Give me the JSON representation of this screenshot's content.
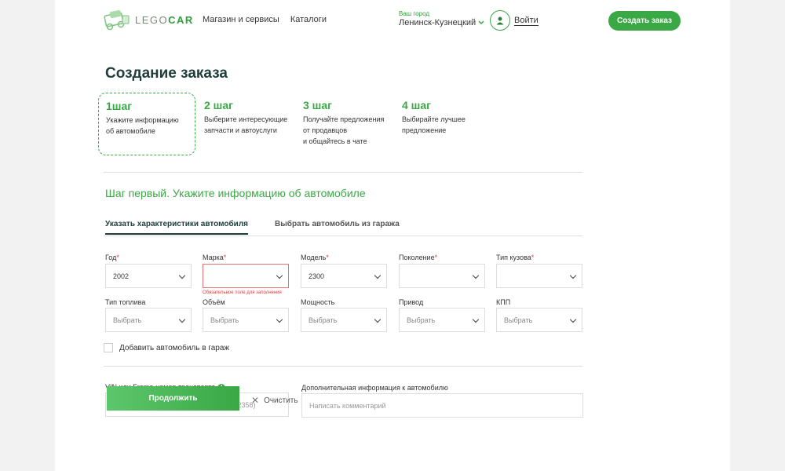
{
  "header": {
    "logo_light": "LEGO",
    "logo_bold": "CAR",
    "nav": [
      "Магазин и сервисы",
      "Каталоги"
    ],
    "city_label": "Ваш город",
    "city_value": "Ленинск-Кузнецкий",
    "login": "Войти",
    "create_order": "Создать заказ"
  },
  "page_title": "Создание заказа",
  "steps": [
    {
      "num": "1шаг",
      "line1": "Укажите информацию",
      "line2": "об автомобиле",
      "line3": ""
    },
    {
      "num": "2 шаг",
      "line1": "Выберите интересующие",
      "line2": "запчасти и автоуслуги",
      "line3": ""
    },
    {
      "num": "3 шаг",
      "line1": "Получайте предложения",
      "line2": "от продавцов",
      "line3": "и общайтесь в чате"
    },
    {
      "num": "4 шаг",
      "line1": "Выбирайте лучшее",
      "line2": "предложение",
      "line3": ""
    }
  ],
  "subtitle": "Шаг первый. Укажите информацию об автомобиле",
  "tabs": [
    "Указать характеристики автомобиля",
    "Выбрать автомобиль из гаража"
  ],
  "fields_row1": [
    {
      "label": "Год",
      "value": "2002"
    },
    {
      "label": "Марка",
      "value": ""
    },
    {
      "label": "Модель",
      "value": "2300"
    },
    {
      "label": "Поколение",
      "value": ""
    },
    {
      "label": "Тип кузова",
      "value": ""
    }
  ],
  "required_mark": "*",
  "error_text": "Обязательное поле для заполнения",
  "fields_row2": [
    {
      "label": "Тип топлива",
      "placeholder": "Выбрать"
    },
    {
      "label": "Объём",
      "placeholder": "Выбрать"
    },
    {
      "label": "Мощность",
      "placeholder": "Выбрать"
    },
    {
      "label": "Привод",
      "placeholder": "Выбрать"
    },
    {
      "label": "КПП",
      "placeholder": "Выбрать"
    }
  ],
  "garage_checkbox": "Добавить автомобиль в гараж",
  "vin": {
    "label": "VIN  или Frame-номер транспорта",
    "placeholder": "WAUBH54B11N111054 (или FNN15-502358)",
    "info": "!"
  },
  "extra": {
    "label": "Дополнительная информация к автомобилю",
    "placeholder": "Написать комментарий"
  },
  "continue_button": "Продолжить",
  "clear_button": "Очистить",
  "colors": {
    "accent": "#3aa845",
    "title": "#1f3d3b",
    "error": "#e53935",
    "background": "#f2f2f2"
  }
}
